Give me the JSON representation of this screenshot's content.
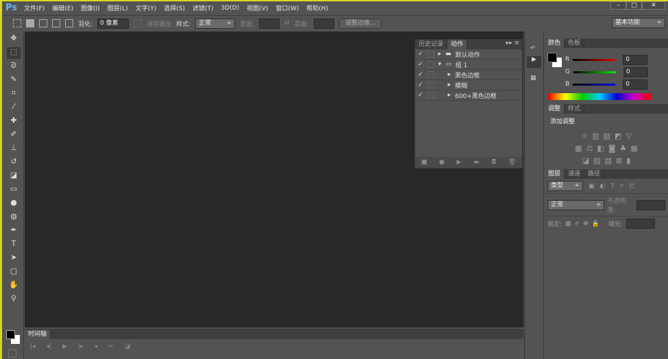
{
  "app": {
    "logo": "Ps"
  },
  "menu": [
    "文件(F)",
    "编辑(E)",
    "图像(I)",
    "图层(L)",
    "文字(Y)",
    "选择(S)",
    "滤镜(T)",
    "3D(D)",
    "视图(V)",
    "窗口(W)",
    "帮助(H)"
  ],
  "window_controls": {
    "minimize": "–",
    "maximize": "□",
    "close": "✕"
  },
  "options": {
    "feather_label": "羽化:",
    "feather_value": "0 像素",
    "antialias_label": "消除锯齿",
    "style_label": "样式:",
    "style_value": "正常",
    "width_label": "宽度:",
    "height_label": "高度:",
    "refine_edge": "调整边缘...",
    "workspace": "基本功能"
  },
  "actions_panel": {
    "tabs": [
      "历史记录",
      "动作"
    ],
    "rows": [
      "默认动作",
      "组 1",
      "黑色边框",
      "模糊",
      "600+黑色边框"
    ]
  },
  "color_panel": {
    "tabs": [
      "颜色",
      "色板"
    ],
    "r_label": "R",
    "g_label": "G",
    "b_label": "B",
    "r": "0",
    "g": "0",
    "b": "0"
  },
  "adjustments_panel": {
    "tabs": [
      "调整",
      "样式"
    ],
    "title": "添加调整"
  },
  "layers_panel": {
    "tabs": [
      "图层",
      "通道",
      "路径"
    ],
    "filter": "类型",
    "blend_mode": "正常",
    "opacity_label": "不透明度:",
    "lock_label": "锁定:",
    "fill_label": "填充:"
  },
  "timeline": {
    "tab": "时间轴"
  }
}
